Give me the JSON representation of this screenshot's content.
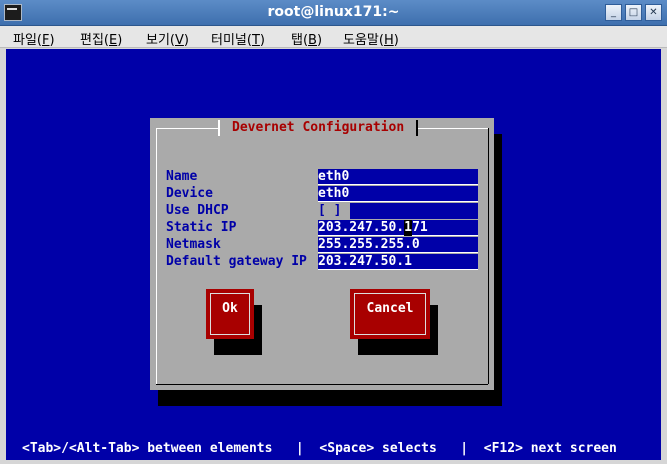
{
  "window": {
    "title": "root@linux171:~",
    "buttons": {
      "minimize": "_",
      "maximize": "□",
      "close": "✕"
    }
  },
  "menu": [
    {
      "label": "파일(",
      "acc": "F",
      "tail": ")"
    },
    {
      "label": "편집(",
      "acc": "E",
      "tail": ")"
    },
    {
      "label": "보기(",
      "acc": "V",
      "tail": ")"
    },
    {
      "label": "터미널(",
      "acc": "T",
      "tail": ")"
    },
    {
      "label": "탭(",
      "acc": "B",
      "tail": ")"
    },
    {
      "label": "도움말(",
      "acc": "H",
      "tail": ")"
    }
  ],
  "dialog": {
    "title": "Devernet Configuration",
    "fields": [
      {
        "label": "Name",
        "value": "eth0"
      },
      {
        "label": "Device",
        "value": "eth0"
      },
      {
        "label": "Use DHCP",
        "value": "[ ]"
      },
      {
        "label": "Static IP",
        "value_before": "203.247.50.",
        "cursor_char": "1",
        "value_after": "71"
      },
      {
        "label": "Netmask",
        "value": "255.255.255.0"
      },
      {
        "label": "Default gateway IP",
        "value": "203.247.50.1"
      }
    ],
    "ok_label": "Ok",
    "cancel_label": "Cancel"
  },
  "status_line": "<Tab>/<Alt-Tab> between elements   |  <Space> selects   |  <F12> next screen",
  "colors": {
    "terminal_bg": "#0000a8",
    "dialog_bg": "#aaaaaa",
    "title_fg": "#a80000",
    "button_bg": "#a80000"
  }
}
